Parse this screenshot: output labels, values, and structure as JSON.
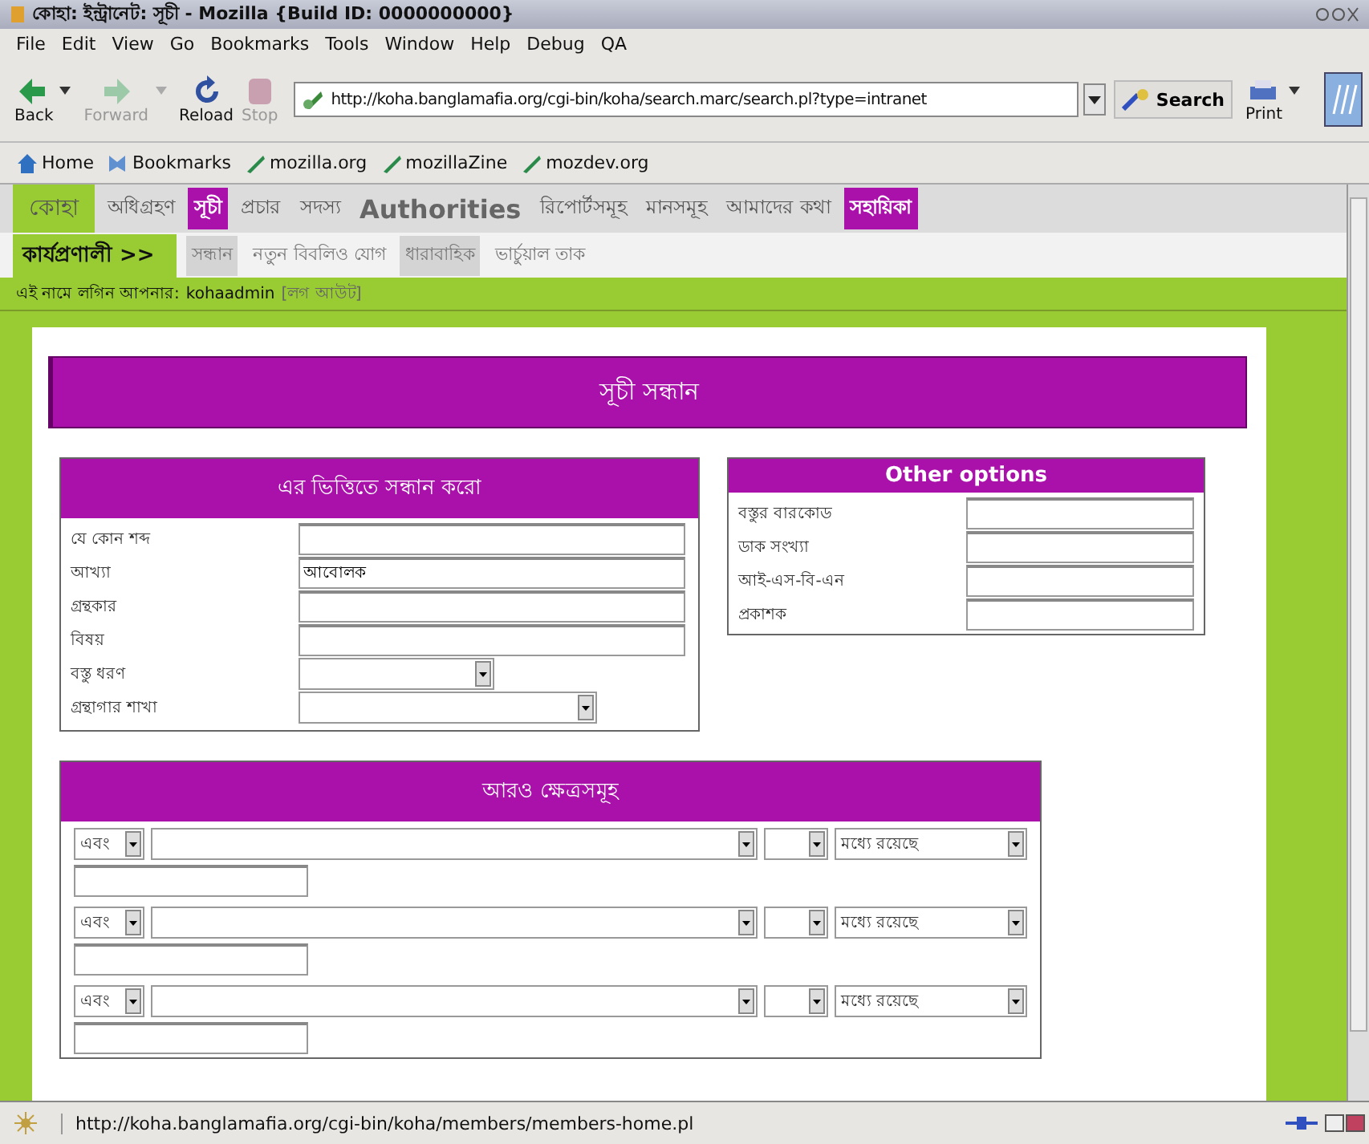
{
  "window": {
    "title": "কোহা: ইন্ট্রানেট: সূচী - Mozilla {Build ID: 0000000000}"
  },
  "menu": [
    "File",
    "Edit",
    "View",
    "Go",
    "Bookmarks",
    "Tools",
    "Window",
    "Help",
    "Debug",
    "QA"
  ],
  "toolbar": {
    "buttons": [
      {
        "label": "Back",
        "kind": "back",
        "disabled": false
      },
      {
        "label": "Forward",
        "kind": "forward",
        "disabled": true
      },
      {
        "label": "Reload",
        "kind": "reload",
        "disabled": false
      },
      {
        "label": "Stop",
        "kind": "stop",
        "disabled": true
      }
    ],
    "url": "http://koha.banglamafia.org/cgi-bin/koha/search.marc/search.pl?type=intranet",
    "search": "Search",
    "print": "Print"
  },
  "bookmarks": [
    {
      "label": "Home",
      "kind": "home"
    },
    {
      "label": "Bookmarks",
      "kind": "bookmarks"
    },
    {
      "label": "mozilla.org",
      "kind": "link"
    },
    {
      "label": "mozillaZine",
      "kind": "link"
    },
    {
      "label": "mozdev.org",
      "kind": "link"
    }
  ],
  "nav": [
    {
      "label": "কোহা",
      "kind": "logo",
      "highlighted": false
    },
    {
      "label": "অধিগ্রহণ",
      "kind": "link",
      "highlighted": false
    },
    {
      "label": "সূচী",
      "kind": "link",
      "highlighted": true
    },
    {
      "label": "প্রচার",
      "kind": "link",
      "highlighted": false
    },
    {
      "label": "সদস্য",
      "kind": "link",
      "highlighted": false
    },
    {
      "label": "Authorities",
      "kind": "strong",
      "highlighted": false
    },
    {
      "label": "রিপোর্টসমূহ",
      "kind": "link",
      "highlighted": false
    },
    {
      "label": "মানসমূহ",
      "kind": "link",
      "highlighted": false
    },
    {
      "label": "আমাদের কথা",
      "kind": "link",
      "highlighted": false
    },
    {
      "label": "সহায়িকা",
      "kind": "link",
      "highlighted": true
    }
  ],
  "subnav": {
    "heading": "কার্যপ্রণালী >>",
    "items": [
      {
        "label": "সন্ধান",
        "highlighted": true
      },
      {
        "label": "নতুন বিবলিও যোগ",
        "highlighted": false
      },
      {
        "label": "ধারাবাহিক",
        "highlighted": true
      },
      {
        "label": "ভার্চুয়াল তাক",
        "highlighted": false
      }
    ]
  },
  "login": {
    "text": "এই নামে লগিন আপনার:",
    "user": "kohaadmin",
    "logout": "[লগ আউট]"
  },
  "page_title": "সূচী সন্ধান",
  "search_by": {
    "title": "এর ভিত্তিতে সন্ধান করো",
    "fields": [
      {
        "label": "যে কোন শব্দ",
        "kind": "text"
      },
      {
        "label": "আখ্যা",
        "kind": "text",
        "value": "আবোলক"
      },
      {
        "label": "গ্রন্থকার",
        "kind": "text"
      },
      {
        "label": "বিষয়",
        "kind": "text"
      },
      {
        "label": "বস্তু ধরণ",
        "kind": "select"
      },
      {
        "label": "গ্রন্থাগার শাখা",
        "kind": "select"
      }
    ]
  },
  "other_options": {
    "title": "Other options",
    "fields": [
      {
        "label": "বস্তুর বারকোড"
      },
      {
        "label": "ডাক সংখ্যা"
      },
      {
        "label": "আই-এস-বি-এন"
      },
      {
        "label": "প্রকাশক"
      }
    ]
  },
  "more_fields": {
    "title": "আরও ক্ষেত্রসমূহ",
    "rows": [
      {
        "operator": "এবং",
        "relation": "মধ্যে রয়েছে"
      },
      {
        "operator": "এবং",
        "relation": "মধ্যে রয়েছে"
      },
      {
        "operator": "এবং",
        "relation": "মধ্যে রয়েছে"
      }
    ]
  },
  "status_bar": {
    "text": "http://koha.banglamafia.org/cgi-bin/koha/members/members-home.pl"
  }
}
